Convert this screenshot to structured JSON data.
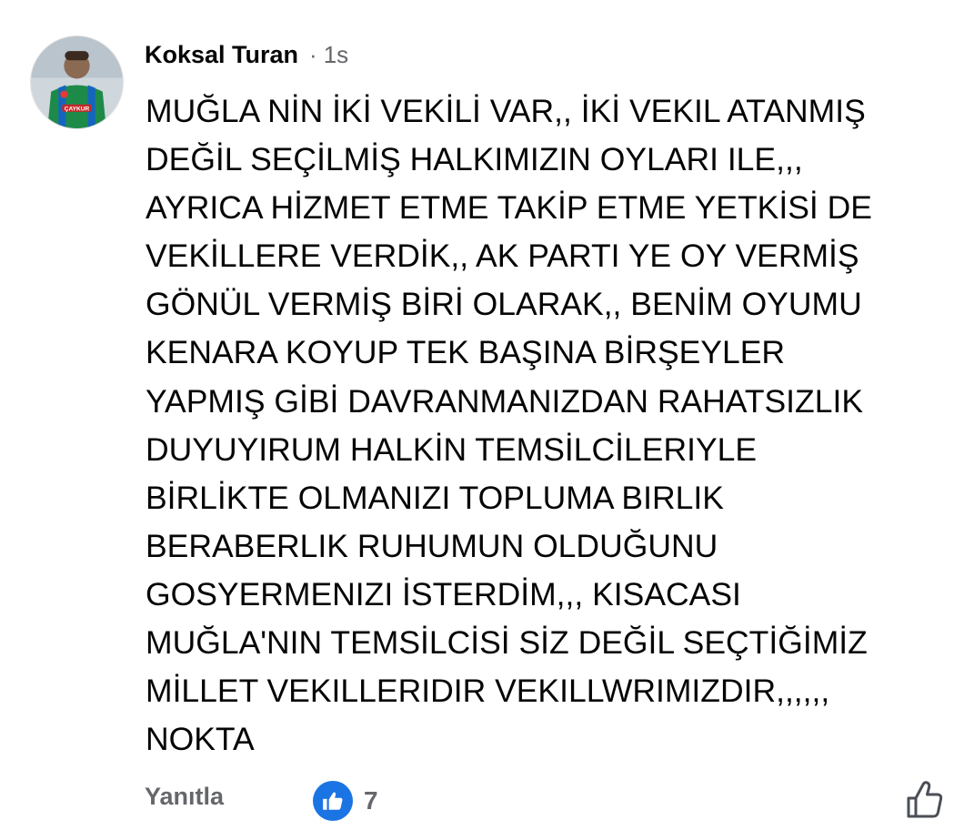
{
  "comment": {
    "author": "Koksal Turan",
    "separator": "·",
    "time": "1s",
    "avatar_shirt_text": "ÇAYKUR",
    "lines": [
      "MUĞLA NİN İKİ VEKİLİ VAR,, İKİ VEKIL ATANMIŞ",
      "DEĞİL SEÇİLMİŞ HALKIMIZIN OYLARI ILE,,,",
      "AYRICA HİZMET ETME TAKİP ETME YETKİSİ DE",
      "VEKİLLERE VERDİK,, AK PARTI YE OY VERMİŞ",
      "GÖNÜL VERMİŞ BİRİ OLARAK,, BENİM OYUMU",
      "KENARA KOYUP TEK BAŞINA BİRŞEYLER",
      "YAPMIŞ GİBİ DAVRANMANIZDAN RAHATSIZLIK",
      "DUYUYIRUM HALKİN TEMSİLCİLERIYLE",
      "BİRLİKTE OLMANIZI TOPLUMA BIRLIK",
      "BERABERLIK RUHUMUN OLDUĞUNU",
      "GOSYERMENIZI İSTERDİM,,, KISACASI",
      "MUĞLA'NIN TEMSİLCİSİ SİZ DEĞİL SEÇTİĞİMİZ",
      "MİLLET VEKILLERIDIR VEKILLWRIMIZDIR,,,,,,",
      "NOKTA"
    ]
  },
  "footer": {
    "reply_label": "Yanıtla",
    "reaction_icon": "like-icon",
    "reaction_count": "7",
    "like_action_icon": "thumbs-up-outline-icon"
  },
  "colors": {
    "text": "#050505",
    "meta": "#65676b",
    "like_blue": "#1b74e4"
  }
}
